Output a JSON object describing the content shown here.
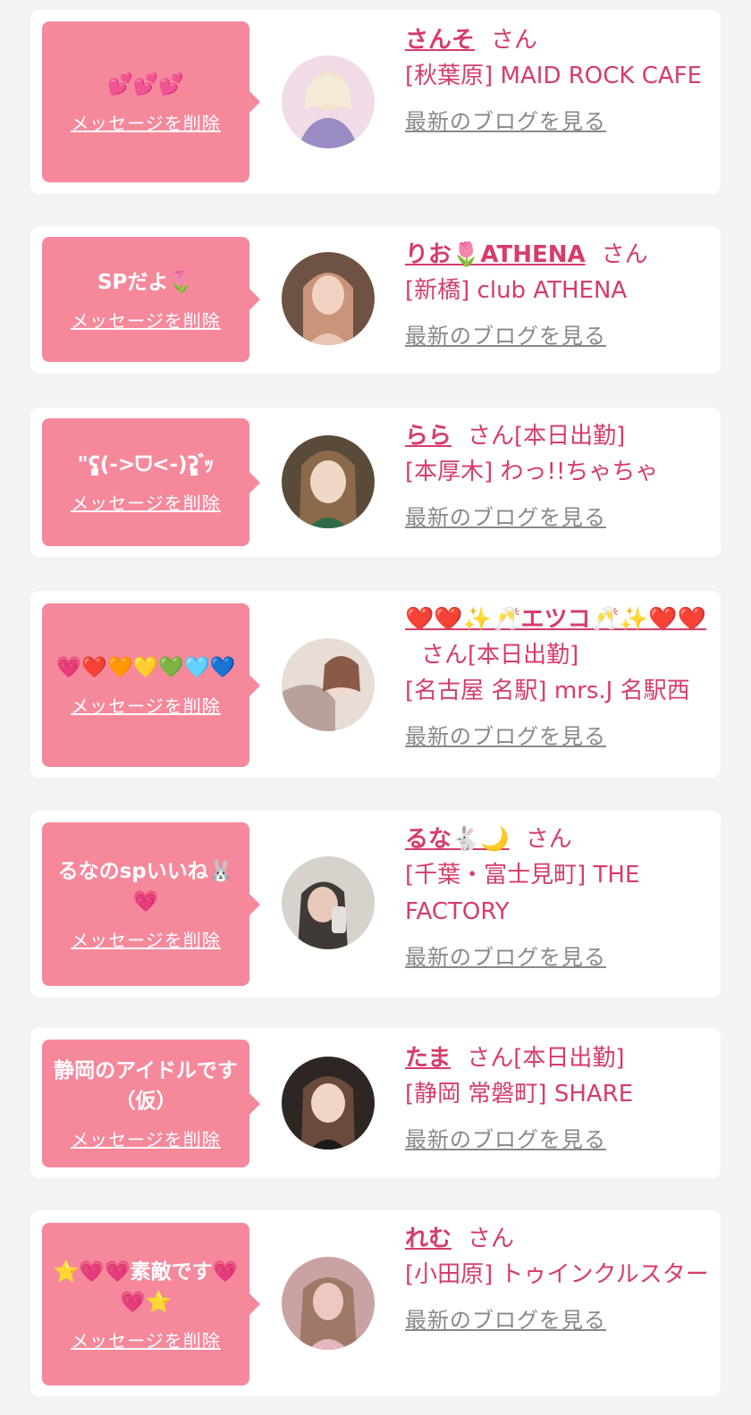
{
  "common": {
    "delete_label": "メッセージを削除",
    "blog_label": "最新のブログを見る",
    "honorific": "さん"
  },
  "items": [
    {
      "message": "💕💕💕",
      "name": "さんそ",
      "status": "",
      "shop": "[秋葉原] MAID ROCK CAFE",
      "avatar_color": "#d8c2e6"
    },
    {
      "message": "SPだよ🌷",
      "name": "りお🌷ATHENA",
      "status": "",
      "shop": "[新橋] club ATHENA",
      "avatar_color": "#c9957a"
    },
    {
      "message": "\"ʕ̡̢̡(->ᗜ<-)ʔ̢̡̢ ゙ｯ",
      "name": "らら",
      "status": "[本日出勤]",
      "shop": "[本厚木] わっ!!ちゃちゃ",
      "avatar_color": "#8a6a4a"
    },
    {
      "message": "💗❤️🧡💛💚🩵💙",
      "name": "❤️❤️✨🥂エツコ🥂✨❤️❤️",
      "status": "[本日出勤]",
      "shop": "[名古屋 名駅] mrs.J 名駅西",
      "avatar_color": "#c8a9a0"
    },
    {
      "message": "るなのspいいね🐰💗",
      "name": "るな🐇🌙",
      "status": "",
      "shop": "[千葉・富士見町] THE FACTORY",
      "avatar_color": "#bdb3ad"
    },
    {
      "message": "静岡のアイドルです（仮）",
      "name": "たま",
      "status": "[本日出勤]",
      "shop": "[静岡 常磐町] SHARE",
      "avatar_color": "#4a3a33"
    },
    {
      "message": "⭐️💗💗素敵です💗💗⭐️",
      "name": "れむ",
      "status": "",
      "shop": "[小田原] トゥインクルスター",
      "avatar_color": "#c9a3a3"
    }
  ]
}
